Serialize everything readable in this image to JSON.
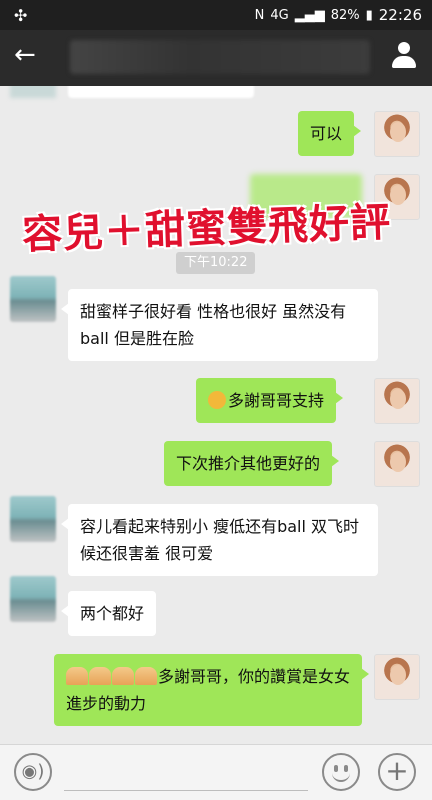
{
  "status_bar": {
    "left_icon": "pinwheel-icon",
    "network": "4G",
    "battery": "82%",
    "time": "22:26"
  },
  "nav": {
    "back_icon": "back-arrow-icon",
    "title": "",
    "profile_icon": "user-icon"
  },
  "watermark": "容兒＋甜蜜雙飛好評",
  "timestamp": "下午10:22",
  "messages": [
    {
      "side": "right",
      "text": "可以"
    },
    {
      "side": "left",
      "text": "甜蜜样子很好看 性格也很好 虽然没有ball 但是胜在脸"
    },
    {
      "side": "right",
      "text": "多謝哥哥支持",
      "emoji": "grimace-emoji"
    },
    {
      "side": "right",
      "text": "下次推介其他更好的"
    },
    {
      "side": "left",
      "text": "容儿看起来特别小 瘦低还有ball 双飞时候还很害羞 很可爱"
    },
    {
      "side": "left",
      "text": "两个都好"
    },
    {
      "side": "right",
      "text": "多謝哥哥，你的讚賞是女女進步的動力",
      "emoji": "pray-emoji"
    }
  ],
  "input_bar": {
    "voice_icon": "voice-icon",
    "emoji_icon": "smiley-icon",
    "plus_icon": "plus-icon"
  },
  "colors": {
    "green_bubble": "#9fe658",
    "white_bubble": "#ffffff",
    "background": "#ebebeb",
    "watermark": "#e0102e"
  }
}
